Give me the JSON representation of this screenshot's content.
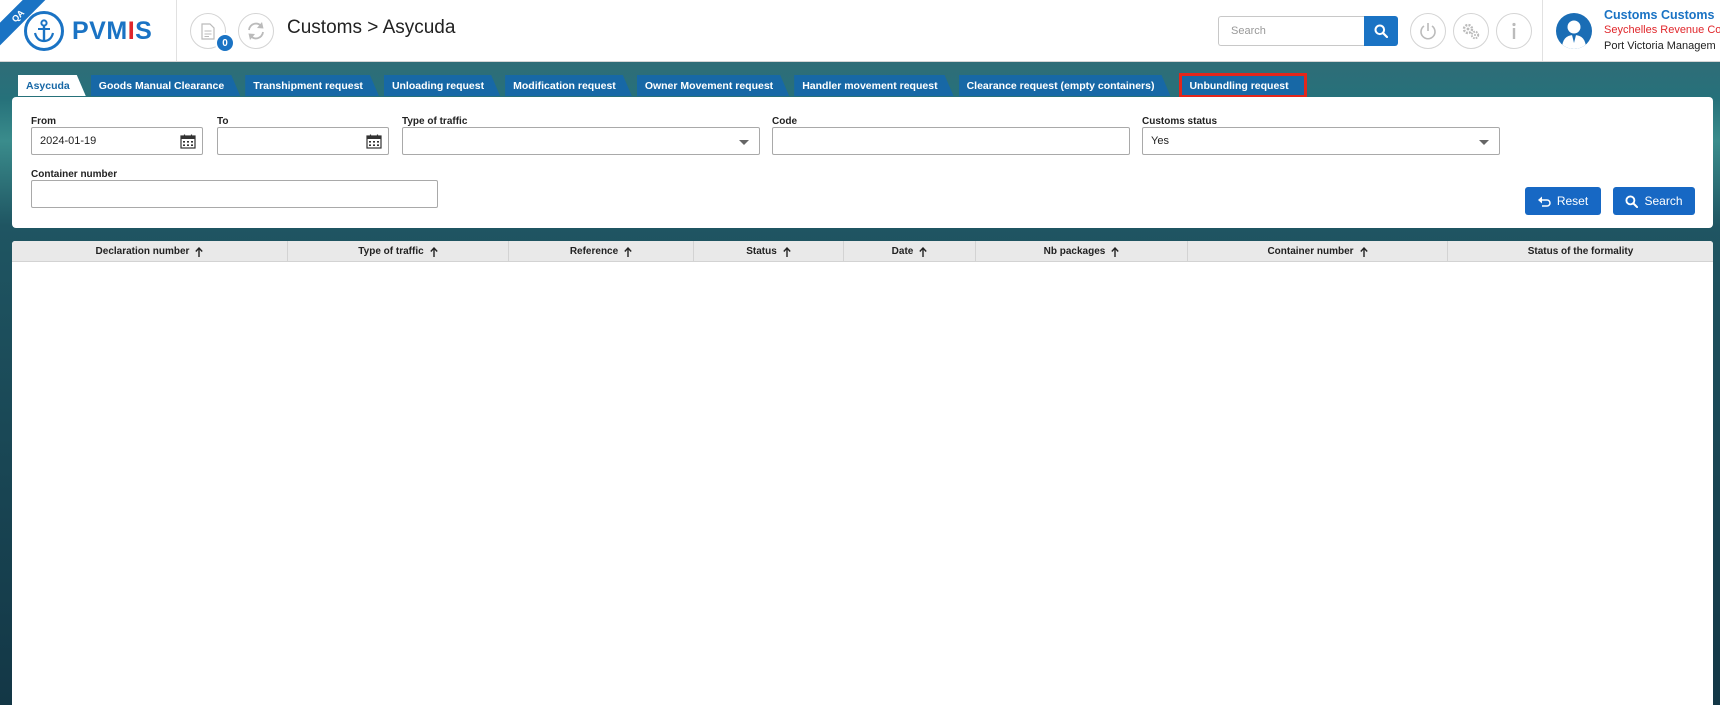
{
  "header": {
    "env_ribbon": "QA",
    "logo_text_a": "PVM",
    "logo_text_accent": "I",
    "logo_text_b": "S",
    "notification_count": "0",
    "page_title": "Customs > Asycuda",
    "search_placeholder": "Search"
  },
  "user": {
    "name": "Customs Customs",
    "organization": "Seychelles Revenue Co",
    "port": "Port Victoria Managem"
  },
  "tabs": [
    {
      "label": "Asycuda",
      "active": true
    },
    {
      "label": "Goods Manual Clearance"
    },
    {
      "label": "Transhipment request"
    },
    {
      "label": "Unloading request"
    },
    {
      "label": "Modification request"
    },
    {
      "label": "Owner Movement request"
    },
    {
      "label": "Handler movement request"
    },
    {
      "label": "Clearance request (empty containers)"
    },
    {
      "label": "Unbundling request",
      "highlighted": true
    }
  ],
  "filters": {
    "from_label": "From",
    "from_value": "2024-01-19",
    "to_label": "To",
    "to_value": "",
    "traffic_label": "Type of traffic",
    "traffic_value": "",
    "code_label": "Code",
    "code_value": "",
    "customs_status_label": "Customs status",
    "customs_status_value": "Yes",
    "container_label": "Container number",
    "container_value": "",
    "reset_label": "Reset",
    "search_label": "Search"
  },
  "grid": {
    "columns": [
      {
        "label": "Declaration number",
        "sortable": true
      },
      {
        "label": "Type of traffic",
        "sortable": true
      },
      {
        "label": "Reference",
        "sortable": true
      },
      {
        "label": "Status",
        "sortable": true
      },
      {
        "label": "Date",
        "sortable": true
      },
      {
        "label": "Nb packages",
        "sortable": true
      },
      {
        "label": "Container number",
        "sortable": true
      },
      {
        "label": "Status of the formality",
        "sortable": false
      }
    ]
  },
  "colors": {
    "primary": "#1a73c4",
    "tab": "#1768a6",
    "accent_red": "#e0262b",
    "highlight": "#e3261b"
  }
}
